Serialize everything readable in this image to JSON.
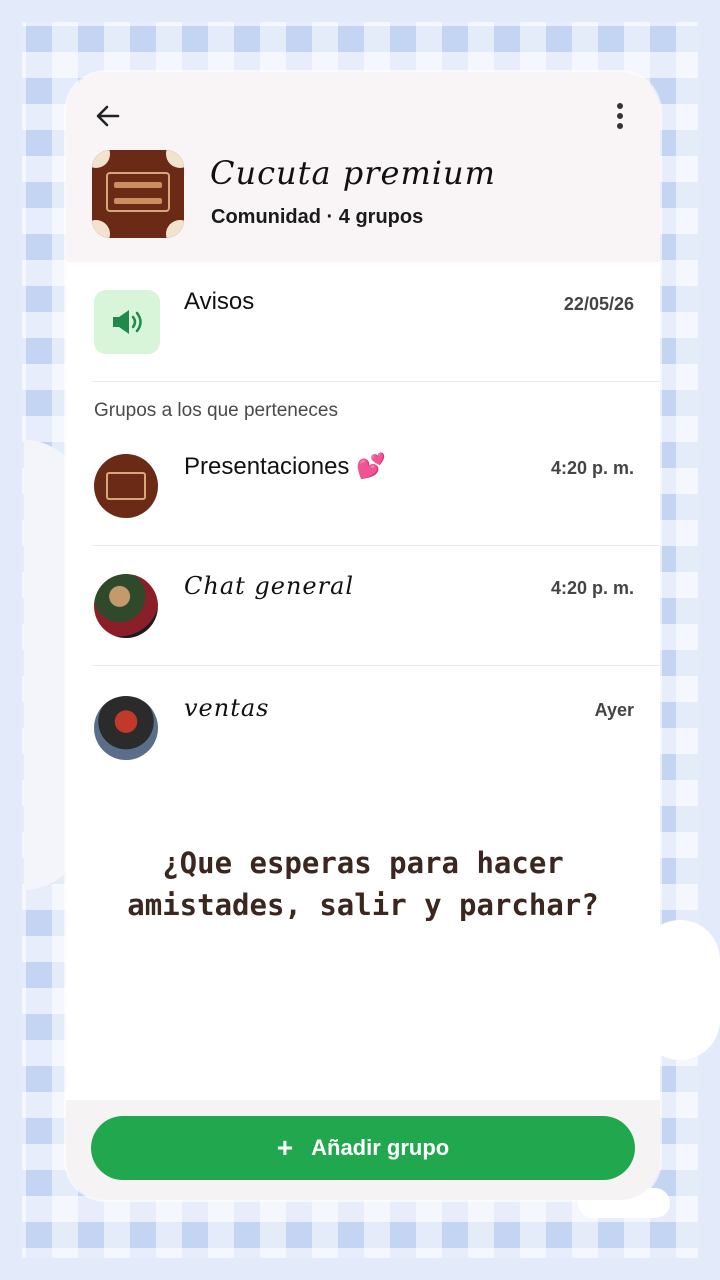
{
  "community": {
    "title": "Cucuta premium",
    "subtitle": "Comunidad · 4 grupos"
  },
  "announcements": {
    "title": "Avisos",
    "date": "22/05/26"
  },
  "section_label": "Grupos a los que perteneces",
  "groups": [
    {
      "title": "Presentaciones 💕",
      "time": "4:20 p. m."
    },
    {
      "title": "Chat general",
      "time": "4:20 p. m."
    },
    {
      "title": "ventas",
      "time": "Ayer"
    }
  ],
  "promo_text": "¿Que esperas para hacer amistades, salir y parchar?",
  "add_group_label": "Añadir grupo",
  "colors": {
    "accent_green": "#21a84f",
    "background_check": "#dfe7f8",
    "promo_text": "#3b2620"
  }
}
